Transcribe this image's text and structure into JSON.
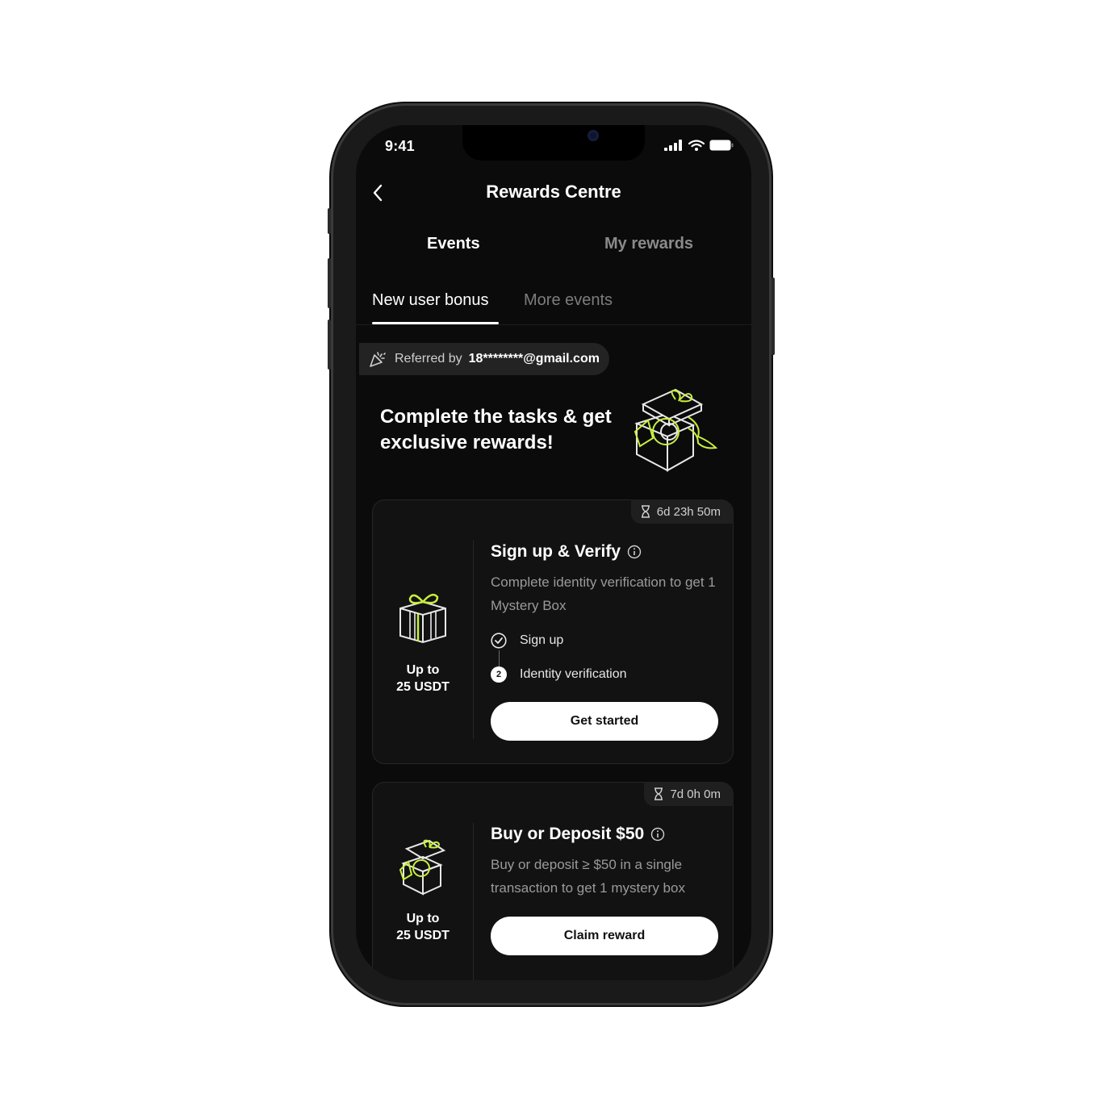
{
  "status_bar": {
    "time": "9:41"
  },
  "header": {
    "title": "Rewards Centre"
  },
  "tabs": [
    {
      "label": "Events",
      "active": true
    },
    {
      "label": "My rewards",
      "active": false
    }
  ],
  "subtabs": [
    {
      "label": "New user bonus",
      "active": true
    },
    {
      "label": "More events",
      "active": false
    }
  ],
  "referral": {
    "prefix": "Referred by",
    "email": "18********@gmail.com"
  },
  "hero": {
    "text": "Complete the tasks & get exclusive rewards!"
  },
  "cards": [
    {
      "timer": "6d 23h 50m",
      "reward_line1": "Up to",
      "reward_line2": "25 USDT",
      "title": "Sign up & Verify",
      "description": "Complete identity verification to get 1 Mystery Box",
      "steps": [
        {
          "label": "Sign up",
          "status": "done"
        },
        {
          "label": "Identity verification",
          "status": "pending",
          "number": "2"
        }
      ],
      "button": "Get started"
    },
    {
      "timer": "7d 0h 0m",
      "reward_line1": "Up to",
      "reward_line2": "25 USDT",
      "title": "Buy or Deposit $50",
      "description": "Buy or deposit ≥ $50 in a single transaction to get 1 mystery box",
      "button": "Claim reward"
    }
  ],
  "colors": {
    "background": "#0b0b0b",
    "accent": "#c8f03c",
    "button_bg": "#ffffff"
  }
}
